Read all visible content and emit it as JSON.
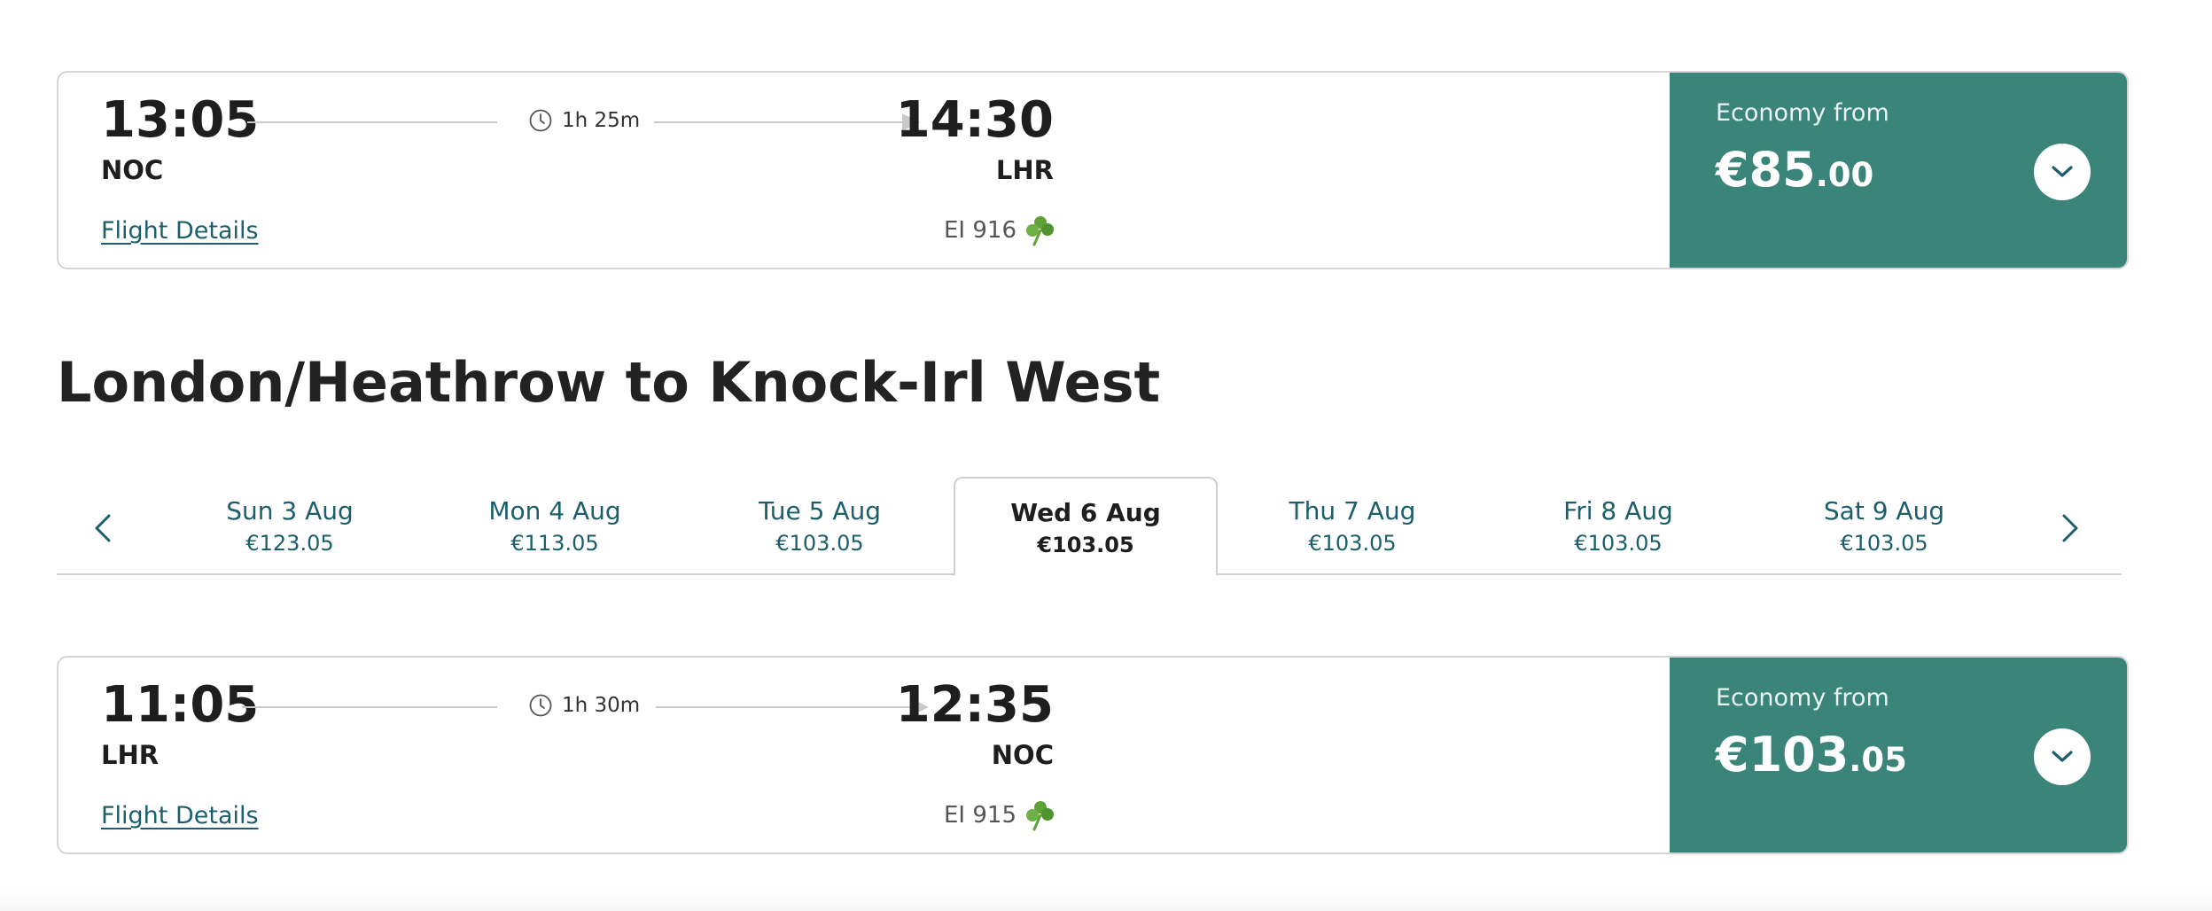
{
  "outbound_flight": {
    "departure_time": "13:05",
    "departure_code": "NOC",
    "duration": "1h 25m",
    "arrival_time": "14:30",
    "arrival_code": "LHR",
    "details_link": "Flight Details",
    "flight_number": "EI 916",
    "price_label": "Economy from",
    "price_main": "€85",
    "price_cents": ".00"
  },
  "return_section": {
    "heading": "London/Heathrow to Knock-Irl West"
  },
  "date_tabs": [
    {
      "label": "Sun 3 Aug",
      "price": "€123.05"
    },
    {
      "label": "Mon 4 Aug",
      "price": "€113.05"
    },
    {
      "label": "Tue 5 Aug",
      "price": "€103.05"
    },
    {
      "label": "Wed 6 Aug",
      "price": "€103.05",
      "selected": true
    },
    {
      "label": "Thu 7 Aug",
      "price": "€103.05"
    },
    {
      "label": "Fri 8 Aug",
      "price": "€103.05"
    },
    {
      "label": "Sat 9 Aug",
      "price": "€103.05"
    }
  ],
  "return_flight": {
    "departure_time": "11:05",
    "departure_code": "LHR",
    "duration": "1h 30m",
    "arrival_time": "12:35",
    "arrival_code": "NOC",
    "details_link": "Flight Details",
    "flight_number": "EI 915",
    "price_label": "Economy from",
    "price_main": "€103",
    "price_cents": ".05"
  },
  "icons": {
    "clock": "clock-icon",
    "shamrock": "shamrock-icon",
    "expand": "chevron-down-icon",
    "prev": "chevron-left-icon",
    "next": "chevron-right-icon"
  },
  "colors": {
    "price_panel": "#3a8479",
    "link": "#1d5e6c",
    "shamrock": "#5fa23a"
  }
}
